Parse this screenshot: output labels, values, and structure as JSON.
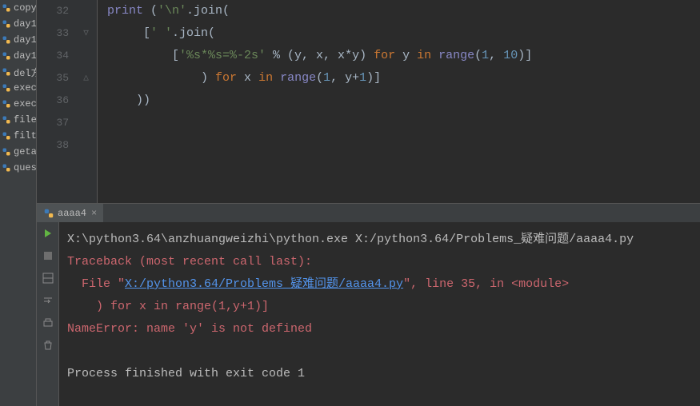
{
  "project_tree": {
    "items": [
      {
        "label": "copy"
      },
      {
        "label": "day1"
      },
      {
        "label": "day1"
      },
      {
        "label": "day1"
      },
      {
        "label": "del方"
      },
      {
        "label": "exec"
      },
      {
        "label": "exec"
      },
      {
        "label": "file_e"
      },
      {
        "label": "filter"
      },
      {
        "label": "geta"
      },
      {
        "label": "ques"
      }
    ]
  },
  "editor": {
    "line_numbers": [
      "32",
      "33",
      "34",
      "35",
      "36",
      "37",
      "38"
    ],
    "fold_markers": {
      "1": "▽",
      "3": "△"
    },
    "code": {
      "l32": {
        "pre": "",
        "fn": "print",
        "post": " ("
      },
      "l32_join": "'\\n'",
      "l32_join2": ".join(",
      "l33_indent": "     [",
      "l33_str": "' '",
      "l33_join": ".join(",
      "l34_indent": "         [",
      "l34_fmt": "'%s*%s=%-2s'",
      "l34_pct": " % (y, x, x*y) ",
      "l34_for": "for",
      "l34_y": " y ",
      "l34_in": "in",
      "l34_range": " range",
      "l34_args": "(",
      "l34_1": "1",
      "l34_c": ", ",
      "l34_10": "10",
      "l34_close": ")]",
      "l35_indent": "             ) ",
      "l35_for": "for",
      "l35_x": " x ",
      "l35_in": "in",
      "l35_range": " range",
      "l35_args": "(",
      "l35_1": "1",
      "l35_c": ", y+",
      "l35_y1": "1",
      "l35_close": ")]",
      "l36_indent": "    ))"
    }
  },
  "run_tab": {
    "label": "aaaa4",
    "close": "×"
  },
  "console": {
    "cmd": "X:\\python3.64\\anzhuangweizhi\\python.exe X:/python3.64/Problems_疑难问题/aaaa4.py",
    "traceback": "Traceback (most recent call last):",
    "file_prefix": "  File \"",
    "file_link": "X:/python3.64/Problems_疑难问题/aaaa4.py",
    "file_suffix": "\", line 35, in <module>",
    "src_line": "    ) for x in range(1,y+1)]",
    "name_error": "NameError: name 'y' is not defined",
    "exit": "Process finished with exit code 1"
  }
}
